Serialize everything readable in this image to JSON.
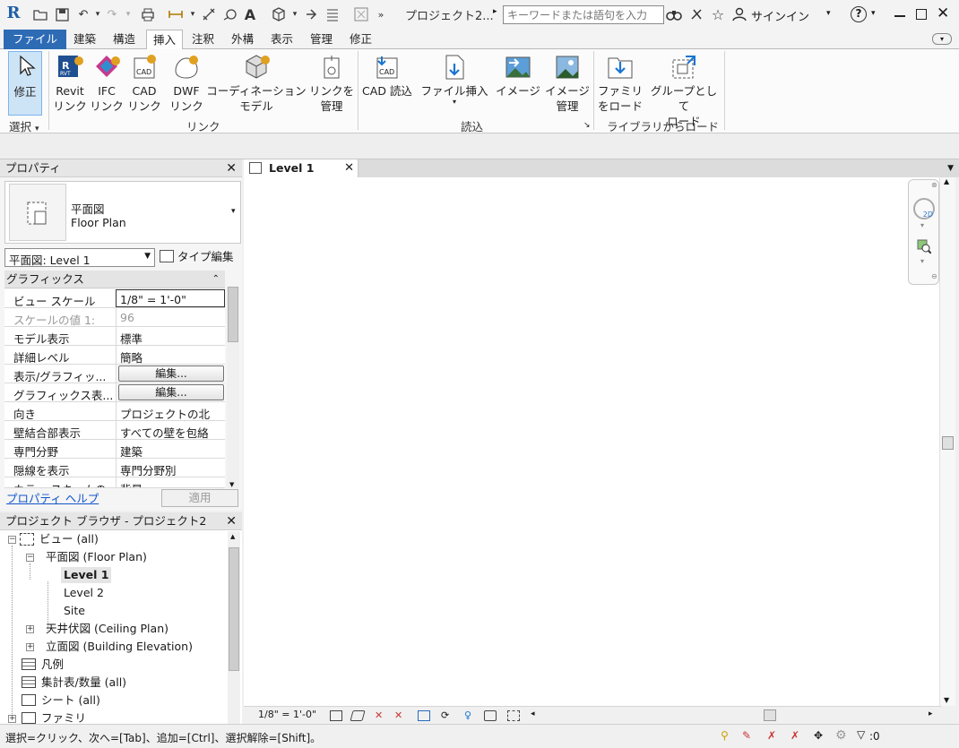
{
  "titlebar": {
    "logo": "R",
    "project_title": "プロジェクト2...",
    "search_placeholder": "キーワードまたは語句を入力",
    "signin_label": "サインイン",
    "help_label": "?"
  },
  "menu_tabs": [
    "ファイル",
    "建築",
    "構造",
    "挿入",
    "注釈",
    "外構",
    "表示",
    "管理",
    "修正"
  ],
  "active_tab": "挿入",
  "ribbon": {
    "select_panel": {
      "button_label": "修正",
      "title": "選択"
    },
    "link_panel": {
      "title": "リンク",
      "buttons": [
        {
          "line1": "Revit",
          "line2": "リンク"
        },
        {
          "line1": "IFC",
          "line2": "リンク"
        },
        {
          "line1": "CAD",
          "line2": "リンク"
        },
        {
          "line1": "DWF",
          "line2": "リンク"
        },
        {
          "line1": "コーディネーション",
          "line2": "モデル"
        },
        {
          "line1": "リンクを",
          "line2": "管理"
        }
      ]
    },
    "import_panel": {
      "title": "読込",
      "buttons": [
        {
          "line1": "CAD 読込",
          "line2": ""
        },
        {
          "line1": "ファイル挿入",
          "line2": "▾"
        },
        {
          "line1": "イメージ",
          "line2": ""
        },
        {
          "line1": "イメージ",
          "line2": "管理"
        }
      ]
    },
    "library_panel": {
      "title": "ライブラリからロード",
      "buttons": [
        {
          "line1": "ファミリ",
          "line2": "をロード"
        },
        {
          "line1": "グループとして",
          "line2": "ロード"
        }
      ]
    }
  },
  "properties": {
    "title": "プロパティ",
    "type_name_line1": "平面図",
    "type_name_line2": "Floor Plan",
    "instance_selector": "平面図: Level 1",
    "edit_type_label": "タイプ編集",
    "section": "グラフィックス",
    "rows": [
      {
        "key": "ビュー スケール",
        "value": "1/8\" = 1'-0\""
      },
      {
        "key": "スケールの値    1:",
        "value": "96"
      },
      {
        "key": "モデル表示",
        "value": "標準"
      },
      {
        "key": "詳細レベル",
        "value": "簡略"
      },
      {
        "key": "表示/グラフィッ...",
        "value": "編集..."
      },
      {
        "key": "グラフィックス表...",
        "value": "編集..."
      },
      {
        "key": "向き",
        "value": "プロジェクトの北"
      },
      {
        "key": "壁結合部表示",
        "value": "すべての壁を包絡"
      },
      {
        "key": "専門分野",
        "value": "建築"
      },
      {
        "key": "隠線を表示",
        "value": "専門分野別"
      },
      {
        "key": "カラー スキームの...",
        "value": "背景"
      }
    ],
    "help_link": "プロパティ ヘルプ",
    "apply_label": "適用"
  },
  "browser": {
    "title": "プロジェクト ブラウザ - プロジェクト2",
    "nodes": [
      {
        "label": "ビュー (all)",
        "level": 0,
        "toggle": "−"
      },
      {
        "label": "平面図 (Floor Plan)",
        "level": 1,
        "toggle": "−"
      },
      {
        "label": "Level 1",
        "level": 2,
        "toggle": ""
      },
      {
        "label": "Level 2",
        "level": 2,
        "toggle": ""
      },
      {
        "label": "Site",
        "level": 2,
        "toggle": ""
      },
      {
        "label": "天井伏図 (Ceiling Plan)",
        "level": 1,
        "toggle": "+"
      },
      {
        "label": "立面図 (Building Elevation)",
        "level": 1,
        "toggle": "+"
      },
      {
        "label": "凡例",
        "level": 0,
        "toggle": ""
      },
      {
        "label": "集計表/数量 (all)",
        "level": 0,
        "toggle": ""
      },
      {
        "label": "シート (all)",
        "level": 0,
        "toggle": ""
      },
      {
        "label": "ファミリ",
        "level": 0,
        "toggle": "+"
      }
    ]
  },
  "view": {
    "tab_title": "Level 1",
    "scale_label": "1/8\" = 1'-0\""
  },
  "status": {
    "message": "選択=クリック、次へ=[Tab]、追加=[Ctrl]、選択解除=[Shift]。",
    "filter_count": ":0"
  }
}
